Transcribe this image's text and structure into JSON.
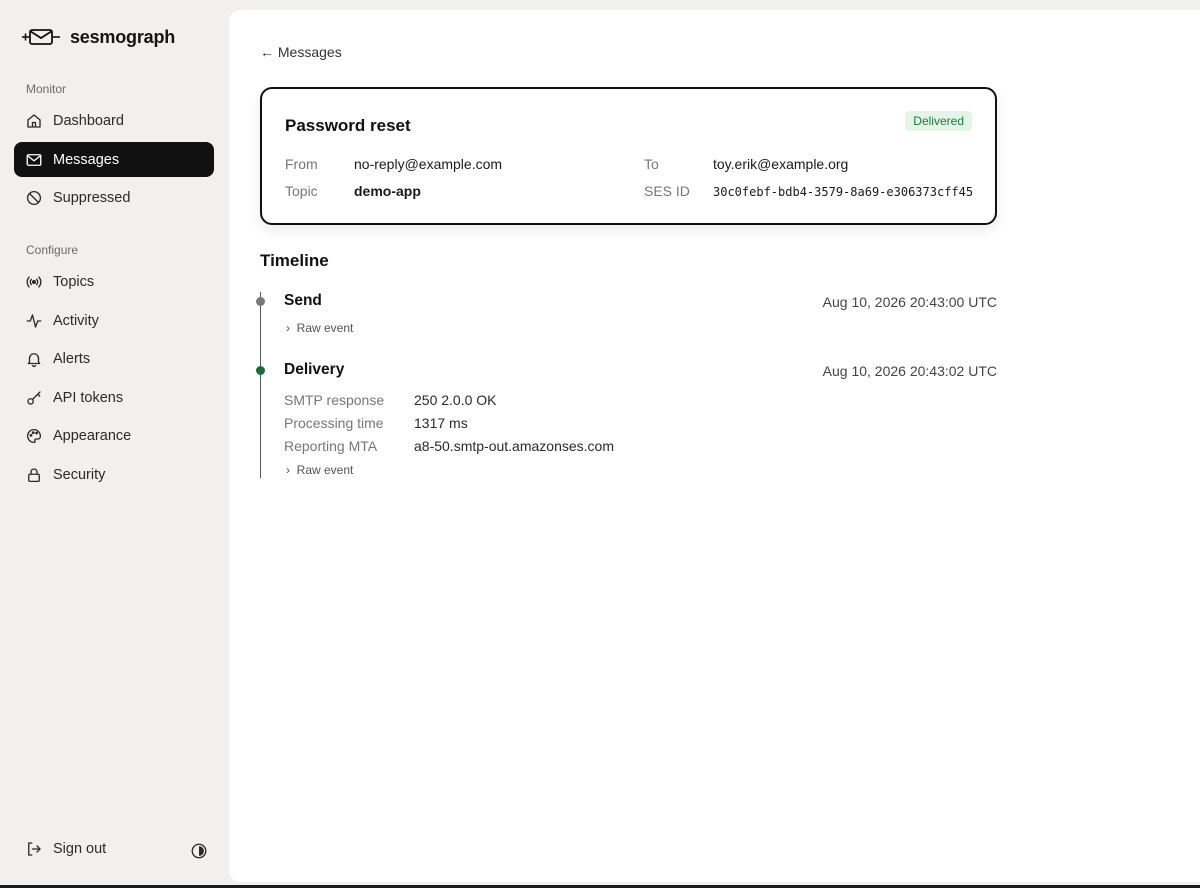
{
  "brand": {
    "name": "sesmograph"
  },
  "sidebar": {
    "monitor_label": "Monitor",
    "configure_label": "Configure",
    "monitor_items": [
      {
        "label": "Dashboard",
        "icon": "home-icon"
      },
      {
        "label": "Messages",
        "icon": "envelope-icon",
        "active": true
      },
      {
        "label": "Suppressed",
        "icon": "ban-icon"
      }
    ],
    "configure_items": [
      {
        "label": "Topics",
        "icon": "broadcast-icon"
      },
      {
        "label": "Activity",
        "icon": "activity-icon"
      },
      {
        "label": "Alerts",
        "icon": "bell-icon"
      },
      {
        "label": "API tokens",
        "icon": "key-icon"
      },
      {
        "label": "Appearance",
        "icon": "palette-icon"
      },
      {
        "label": "Security",
        "icon": "lock-icon"
      }
    ],
    "sign_out_label": "Sign out"
  },
  "main": {
    "back_label": "← Messages",
    "message": {
      "title": "Password reset",
      "status": "Delivered",
      "from_label": "From",
      "from_value": "no-reply@example.com",
      "to_label": "To",
      "to_value": "toy.erik@example.org",
      "topic_label": "Topic",
      "topic_value": "demo-app",
      "ses_label": "SES ID",
      "ses_value": "30c0febf-bdb4-3579-8a69-e306373cff45"
    },
    "timeline": {
      "title": "Timeline",
      "events": [
        {
          "name": "Send",
          "time": "Aug 10, 2026 20:43:00 UTC",
          "raw_label": "Raw event"
        },
        {
          "name": "Delivery",
          "time": "Aug 10, 2026 20:43:02 UTC",
          "details": [
            {
              "label": "SMTP response",
              "value": "250 2.0.0 OK"
            },
            {
              "label": "Processing time",
              "value": "1317 ms"
            },
            {
              "label": "Reporting MTA",
              "value": "a8-50.smtp-out.amazonses.com"
            }
          ],
          "raw_label": "Raw event"
        }
      ]
    }
  },
  "colors": {
    "accent": "#111111",
    "delivered_bg": "#e4f5e8",
    "delivered_fg": "#1c7a3c",
    "delivery_dot": "#1c6b36",
    "send_dot": "#777777"
  }
}
